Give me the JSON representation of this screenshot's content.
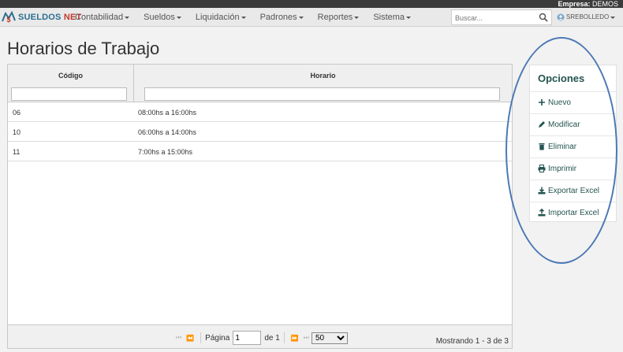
{
  "topbar": {
    "company_label": "Empresa:",
    "company_value": "DEMOS"
  },
  "brand": {
    "part1": "SUELDOS",
    "part2": "NET"
  },
  "menu": [
    {
      "label": "Contabilidad"
    },
    {
      "label": "Sueldos"
    },
    {
      "label": "Liquidación"
    },
    {
      "label": "Padrones"
    },
    {
      "label": "Reportes"
    },
    {
      "label": "Sistema"
    }
  ],
  "search": {
    "placeholder": "Buscar...",
    "value": ""
  },
  "user": {
    "name": "SREBOLLEDO"
  },
  "page": {
    "title": "Horarios de Trabajo"
  },
  "grid": {
    "columns": [
      {
        "label": "Código"
      },
      {
        "label": "Horario"
      }
    ],
    "rows": [
      {
        "codigo": "06",
        "horario": "08:00hs a 16:00hs"
      },
      {
        "codigo": "10",
        "horario": "06:00hs a 14:00hs"
      },
      {
        "codigo": "11",
        "horario": "7:00hs a 15:00hs"
      }
    ],
    "pager": {
      "page_label": "Página",
      "page_value": "1",
      "of_label": "de 1",
      "page_size": "50",
      "showing": "Mostrando 1 - 3 de 3"
    }
  },
  "options": {
    "title": "Opciones",
    "items": [
      {
        "label": "Nuevo",
        "icon": "plus-icon"
      },
      {
        "label": "Modificar",
        "icon": "pencil-icon"
      },
      {
        "label": "Eliminar",
        "icon": "trash-icon"
      },
      {
        "label": "Imprimir",
        "icon": "printer-icon"
      },
      {
        "label": "Exportar Excel",
        "icon": "download-icon"
      },
      {
        "label": "Importar Excel",
        "icon": "upload-icon"
      }
    ]
  },
  "colors": {
    "accent": "#24544f",
    "annotation": "#4b78b5",
    "brand_blue": "#2a6f8f",
    "brand_red": "#c0392b"
  }
}
